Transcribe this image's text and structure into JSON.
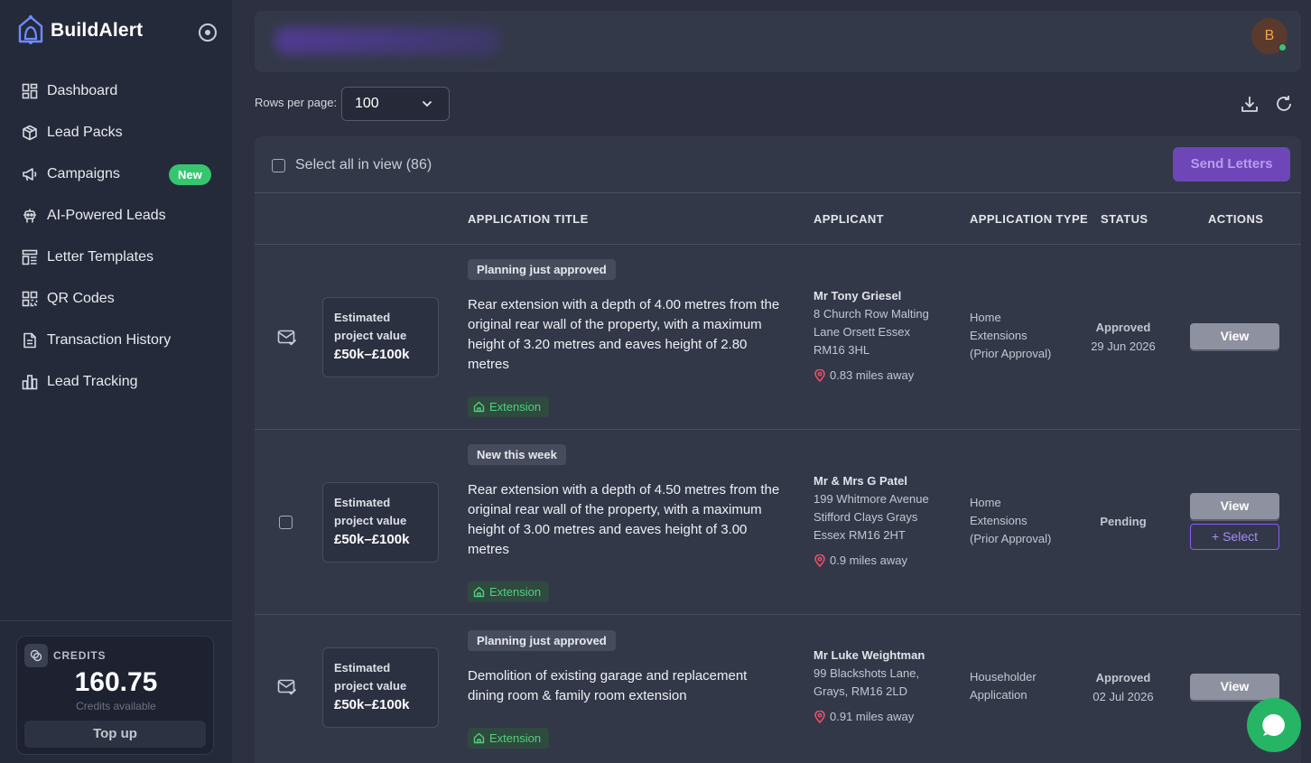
{
  "brand": {
    "name": "BuildAlert"
  },
  "sidebar": {
    "items": [
      {
        "label": "Dashboard",
        "icon": "dashboard-icon"
      },
      {
        "label": "Lead Packs",
        "icon": "box-icon"
      },
      {
        "label": "Campaigns",
        "icon": "megaphone-icon",
        "badge": "New"
      },
      {
        "label": "AI-Powered Leads",
        "icon": "robot-icon"
      },
      {
        "label": "Letter Templates",
        "icon": "template-icon"
      },
      {
        "label": "QR Codes",
        "icon": "qr-code-icon"
      },
      {
        "label": "Transaction History",
        "icon": "receipt-icon"
      },
      {
        "label": "Lead Tracking",
        "icon": "bar-chart-icon"
      }
    ]
  },
  "credits": {
    "label": "CREDITS",
    "value": "160.75",
    "sub": "Credits available",
    "topup": "Top up"
  },
  "header": {
    "avatar_initial": "B"
  },
  "toolbar": {
    "rows_label": "Rows per page:",
    "rows_value": "100"
  },
  "table": {
    "select_all": "Select all in view (86)",
    "send_letters": "Send Letters",
    "columns": [
      "APPLICATION TITLE",
      "APPLICANT",
      "APPLICATION TYPE",
      "STATUS",
      "ACTIONS"
    ],
    "rows": [
      {
        "est_label_1": "Estimated",
        "est_label_2": "project value",
        "est_value": "£50k–£100k",
        "tag": "Planning just approved",
        "title": "Rear extension with a depth of 4.00 metres from the original rear wall of the property, with a maximum height of 3.20 metres and eaves height of 2.80 metres",
        "category": "Extension",
        "applicant_name": "Mr Tony Griesel",
        "address_1": "8 Church Row Malting",
        "address_2": "Lane Orsett Essex",
        "address_3": "RM16 3HL",
        "distance": "0.83 miles away",
        "type_1": "Home",
        "type_2": "Extensions",
        "type_3": "(Prior Approval)",
        "status": "Approved",
        "status_date": "29 Jun 2026",
        "view": "View"
      },
      {
        "est_label_1": "Estimated",
        "est_label_2": "project value",
        "est_value": "£50k–£100k",
        "tag": "New this week",
        "title": "Rear extension with a depth of 4.50 metres from the original rear wall of the property, with a maximum height of 3.00 metres and eaves height of 3.00 metres",
        "category": "Extension",
        "applicant_name": "Mr & Mrs G Patel",
        "address_1": "199 Whitmore Avenue",
        "address_2": "Stifford Clays Grays",
        "address_3": "Essex RM16 2HT",
        "distance": "0.9 miles away",
        "type_1": "Home",
        "type_2": "Extensions",
        "type_3": "(Prior Approval)",
        "status": "Pending",
        "view": "View",
        "select": "Select"
      },
      {
        "est_label_1": "Estimated",
        "est_label_2": "project value",
        "est_value": "£50k–£100k",
        "tag": "Planning just approved",
        "title": "Demolition of existing garage and replacement dining room & family room extension",
        "category": "Extension",
        "applicant_name": "Mr Luke Weightman",
        "address_1": "99 Blackshots Lane,",
        "address_2": "Grays, RM16 2LD",
        "distance": "0.91 miles away",
        "type_1": "Householder",
        "type_2": "Application",
        "status": "Approved",
        "status_date": "02 Jul 2026",
        "view": "View"
      }
    ]
  },
  "colors": {
    "accent_purple": "#6f46b8",
    "success_green": "#35c66f",
    "sidebar_bg": "#252a3a",
    "page_bg": "#2c3040"
  }
}
